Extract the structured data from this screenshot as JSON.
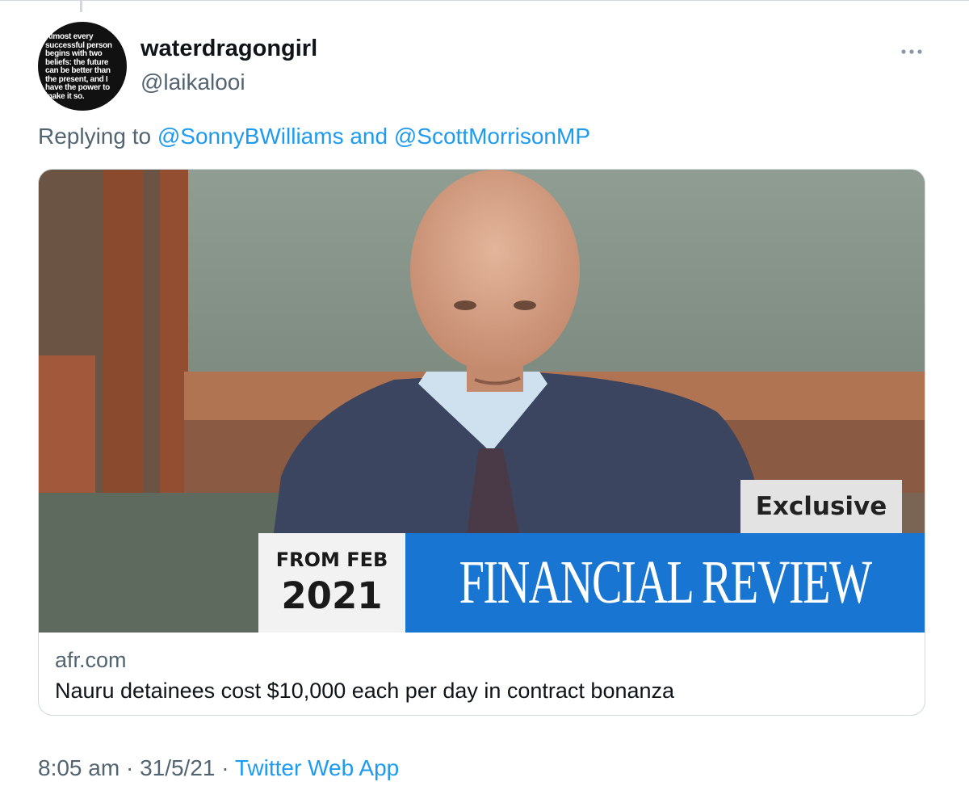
{
  "tweet": {
    "avatar_quote": "Almost every successful person begins with two beliefs: the future can be better than the present, and I have the power to make it so.",
    "display_name": "waterdragongirl",
    "handle": "@laikalooi",
    "more_icon": "ellipsis-icon",
    "reply_prefix": "Replying to",
    "reply_mention_1": "@SonnyBWilliams",
    "reply_conjunction": "and",
    "reply_mention_2": "@ScottMorrisonMP",
    "time": "8:05 am",
    "date": "31/5/21",
    "separator": "·",
    "source_app": "Twitter Web App"
  },
  "link_card": {
    "image_exclusive": "Exclusive",
    "image_date_top": "FROM FEB",
    "image_date_bottom": "2021",
    "image_masthead": "FINANCIAL REVIEW",
    "domain": "afr.com",
    "title": "Nauru detainees cost $10,000 each per day in contract bonanza"
  },
  "colors": {
    "link_blue": "#1d9bf0",
    "secondary_text": "#536471",
    "primary_text": "#0f1419",
    "masthead_blue": "#1875d1"
  }
}
